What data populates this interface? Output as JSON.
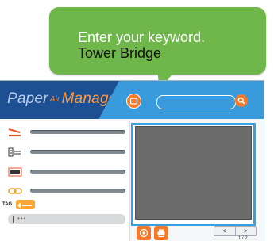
{
  "callout": {
    "line1": "Enter your keyword.",
    "line2": "Tower Bridge"
  },
  "app": {
    "logo": {
      "paper": "Paper",
      "air": "Air",
      "manager": "Manager"
    },
    "search": {
      "placeholder": ""
    },
    "sidebar": {
      "tag_label": "TAG",
      "tag_field_value": "•••"
    },
    "pager": {
      "prev": "<",
      "next": ">",
      "page": "1 / 2"
    }
  },
  "colors": {
    "callout_green": "#6fb74a",
    "header_blue": "#3a9bdc",
    "logo_navy": "#1d4f93",
    "accent_orange": "#f47a29",
    "preview_gray": "#6b6b6b"
  },
  "icons": {
    "header_button": "scan-icon",
    "search_button": "search-icon",
    "sidebar": [
      "scanner-icon",
      "receipt-icon",
      "ocr-icon",
      "link-icon"
    ],
    "actions": [
      "email-icon",
      "print-icon"
    ]
  }
}
